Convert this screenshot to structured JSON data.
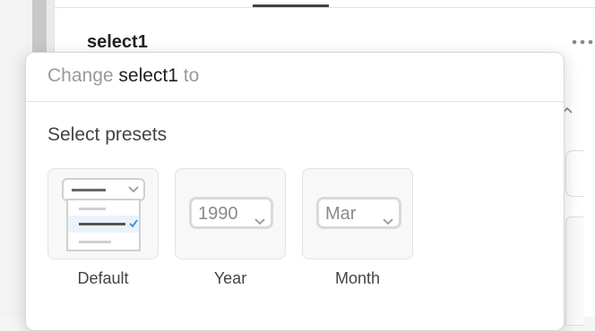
{
  "background": {
    "component_name": "select1"
  },
  "popover": {
    "header": {
      "prefix": "Change",
      "component": "select1",
      "suffix": "to"
    },
    "section_title": "Select presets",
    "presets": [
      {
        "label": "Default",
        "icon": "dropdown-list-preview-icon"
      },
      {
        "label": "Year",
        "value": "1990",
        "icon": "chevron-down-icon"
      },
      {
        "label": "Month",
        "value": "Mar",
        "icon": "chevron-down-icon"
      }
    ]
  },
  "colors": {
    "accent": "#4a90d9",
    "border": "#e3e3e3",
    "muted_text": "#9a9a9a"
  }
}
